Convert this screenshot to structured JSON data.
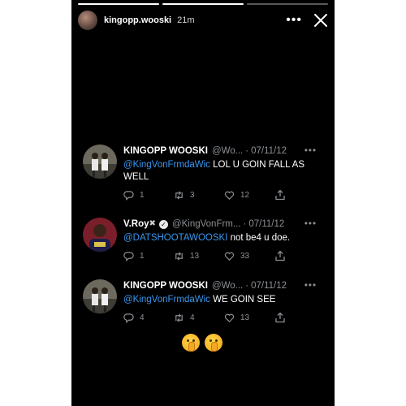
{
  "story": {
    "username": "kingopp.wooski",
    "time_ago": "21m",
    "more_label": "•••",
    "progress_segments": [
      1,
      1,
      0
    ]
  },
  "tweets": [
    {
      "name": "KINGOPP WOOSKI",
      "handle": "@Wo...",
      "sep": "·",
      "date": "07/11/12",
      "more": "•••",
      "mention": "@KingVonFrmdaWic",
      "text": " LOL U GOIN FALL AS WELL",
      "replies": "1",
      "retweets": "3",
      "likes": "12"
    },
    {
      "name": "V.Roy",
      "name_suffix": "✖",
      "verified": true,
      "handle": "@KingVonFrm...",
      "sep": "·",
      "date": "07/11/12",
      "more": "•••",
      "mention": "@DATSHOOTAWOOSKI",
      "text": " not be4 u doe.",
      "replies": "1",
      "retweets": "13",
      "likes": "33"
    },
    {
      "name": "KINGOPP WOOSKI",
      "handle": "@Wo...",
      "sep": "·",
      "date": "07/11/12",
      "more": "•••",
      "mention": "@KingVonFrmdaWic",
      "text": " WE GOIN SEE",
      "replies": "4",
      "retweets": "4",
      "likes": "13"
    }
  ],
  "stickers": [
    "shushing-face-emoji",
    "shushing-face-emoji"
  ],
  "colors": {
    "background": "#000000",
    "mention": "#3897f0",
    "secondary_text": "#8b8f94"
  }
}
